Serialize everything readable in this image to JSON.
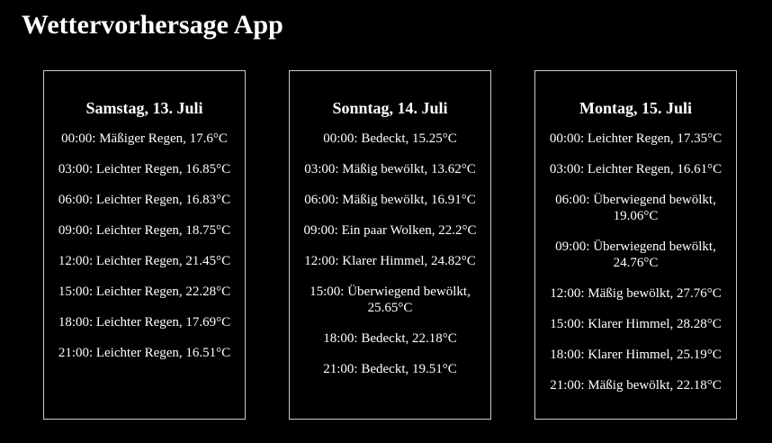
{
  "app": {
    "title": "Wettervorhersage App"
  },
  "days": [
    {
      "heading": "Samstag, 13. Juli",
      "forecasts": [
        "00:00: Mäßiger Regen, 17.6°C",
        "03:00: Leichter Regen, 16.85°C",
        "06:00: Leichter Regen, 16.83°C",
        "09:00: Leichter Regen, 18.75°C",
        "12:00: Leichter Regen, 21.45°C",
        "15:00: Leichter Regen, 22.28°C",
        "18:00: Leichter Regen, 17.69°C",
        "21:00: Leichter Regen, 16.51°C"
      ]
    },
    {
      "heading": "Sonntag, 14. Juli",
      "forecasts": [
        "00:00: Bedeckt, 15.25°C",
        "03:00: Mäßig bewölkt, 13.62°C",
        "06:00: Mäßig bewölkt, 16.91°C",
        "09:00: Ein paar Wolken, 22.2°C",
        "12:00: Klarer Himmel, 24.82°C",
        "15:00: Überwiegend bewölkt, 25.65°C",
        "18:00: Bedeckt, 22.18°C",
        "21:00: Bedeckt, 19.51°C"
      ]
    },
    {
      "heading": "Montag, 15. Juli",
      "forecasts": [
        "00:00: Leichter Regen, 17.35°C",
        "03:00: Leichter Regen, 16.61°C",
        "06:00: Überwiegend bewölkt, 19.06°C",
        "09:00: Überwiegend bewölkt, 24.76°C",
        "12:00: Mäßig bewölkt, 27.76°C",
        "15:00: Klarer Himmel, 28.28°C",
        "18:00: Klarer Himmel, 25.19°C",
        "21:00: Mäßig bewölkt, 22.18°C"
      ]
    }
  ]
}
